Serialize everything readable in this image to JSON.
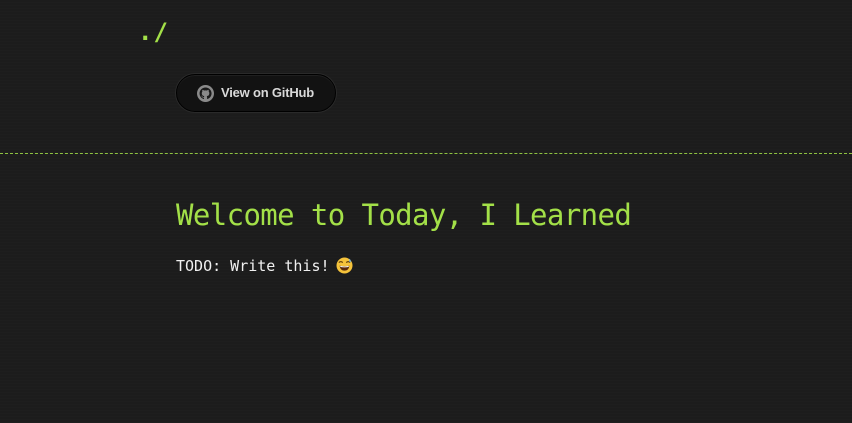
{
  "header": {
    "logo_text": "./",
    "github_button": {
      "label": "View on GitHub",
      "icon": "github-icon"
    }
  },
  "main": {
    "title": "Welcome to Today, I Learned",
    "body": "TODO: Write this!",
    "emoji": "grinning-sweat-emoji"
  },
  "colors": {
    "background": "#1c1c1c",
    "accent": "#a3e048",
    "text": "#f0f0f0",
    "button_bg": "#121212"
  }
}
